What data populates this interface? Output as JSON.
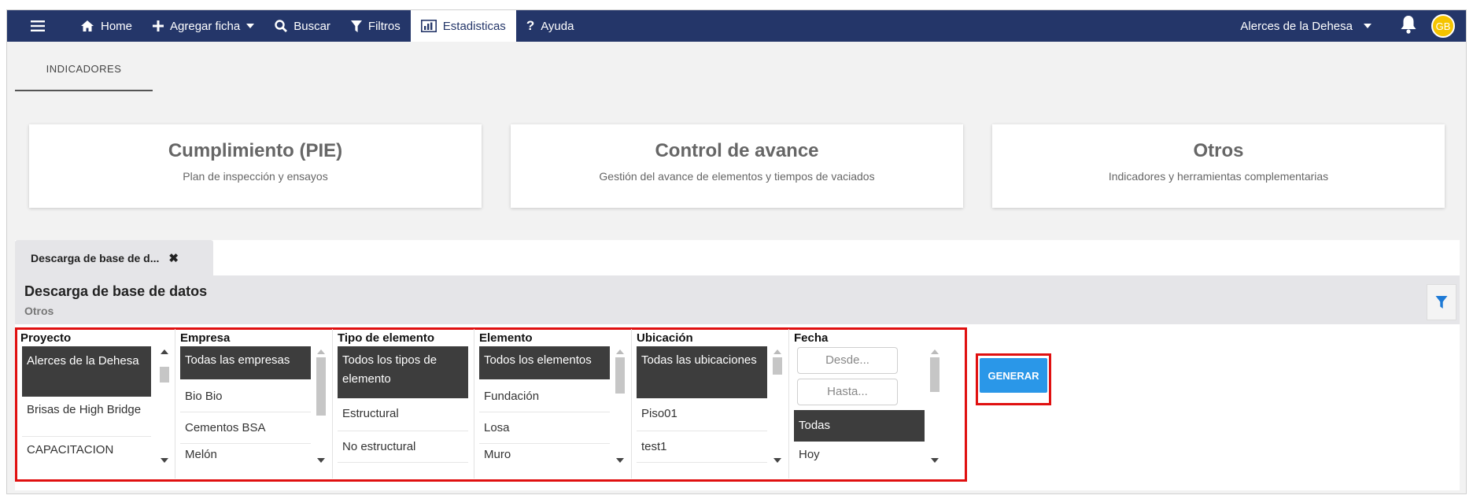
{
  "nav": {
    "home": "Home",
    "agregar": "Agregar ficha",
    "buscar": "Buscar",
    "filtros": "Filtros",
    "estadisticas": "Estadisticas",
    "ayuda": "Ayuda",
    "project": "Alerces de la Dehesa",
    "avatar": "GB"
  },
  "indicadores_tab": "INDICADORES",
  "cards": [
    {
      "title": "Cumplimiento (PIE)",
      "subtitle": "Plan de inspección y ensayos"
    },
    {
      "title": "Control de avance",
      "subtitle": "Gestión del avance de elementos y tiempos de vaciados"
    },
    {
      "title": "Otros",
      "subtitle": "Indicadores y herramientas complementarias"
    }
  ],
  "report": {
    "tab_label": "Descarga de base de d...",
    "title": "Descarga de base de datos",
    "subtitle": "Otros",
    "generate_label": "GENERAR"
  },
  "filters": {
    "proyecto": {
      "label": "Proyecto",
      "options": [
        "Alerces de la Dehesa",
        "Brisas de High Bridge",
        "CAPACITACION"
      ],
      "selected": 0
    },
    "empresa": {
      "label": "Empresa",
      "options": [
        "Todas las empresas",
        "Bio Bio",
        "Cementos BSA",
        "Melón"
      ],
      "selected": 0
    },
    "tipo": {
      "label": "Tipo de elemento",
      "options": [
        "Todos los tipos de elemento",
        "Estructural",
        "No estructural"
      ],
      "selected": 0
    },
    "elemento": {
      "label": "Elemento",
      "options": [
        "Todos los elementos",
        "Fundación",
        "Losa",
        "Muro"
      ],
      "selected": 0
    },
    "ubicacion": {
      "label": "Ubicación",
      "options": [
        "Todas las ubicaciones",
        "Piso01",
        "test1"
      ],
      "selected": 0
    },
    "fecha": {
      "label": "Fecha",
      "desde_placeholder": "Desde...",
      "hasta_placeholder": "Hasta...",
      "options": [
        "Todas",
        "Hoy"
      ],
      "selected": 0
    }
  },
  "colors": {
    "nav_bg": "#243669",
    "selected_bg": "#3d3d3d",
    "generate_bg": "#2a97e8",
    "highlight_border": "#e01010",
    "avatar_bg": "#f5c400"
  }
}
